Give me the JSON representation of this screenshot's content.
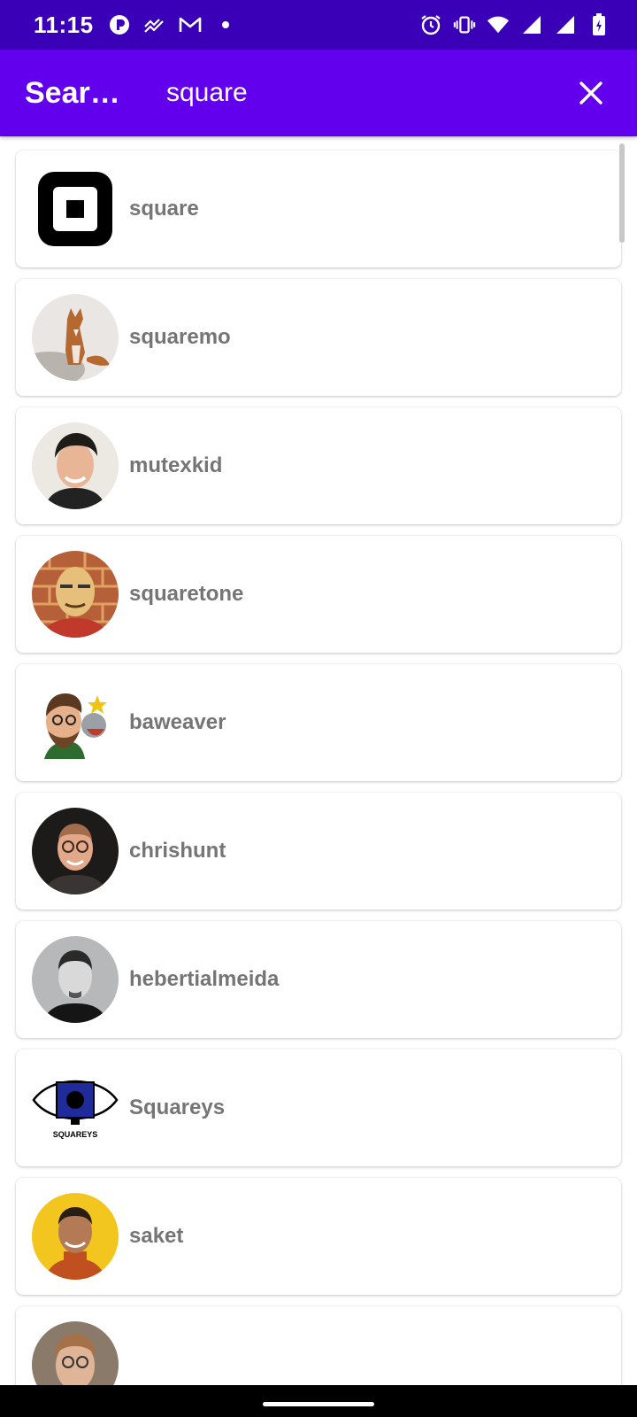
{
  "status_bar": {
    "time": "11:15",
    "left_icons": [
      "app-notification-icon",
      "analytics-icon",
      "gmail-icon",
      "dot-icon"
    ],
    "right_icons": [
      "alarm-icon",
      "vibrate-icon",
      "wifi-icon",
      "signal-icon",
      "signal-icon",
      "battery-charging-icon"
    ]
  },
  "app_bar": {
    "title": "Sear…",
    "search_value": "square",
    "background": "#6200ee",
    "close_icon": "close-icon"
  },
  "results": [
    {
      "name": "square",
      "avatar": "square-logo"
    },
    {
      "name": "squaremo",
      "avatar": "fox-photo"
    },
    {
      "name": "mutexkid",
      "avatar": "person-photo"
    },
    {
      "name": "squaretone",
      "avatar": "person-photo"
    },
    {
      "name": "baweaver",
      "avatar": "cartoon-avatar"
    },
    {
      "name": "chrishunt",
      "avatar": "person-photo"
    },
    {
      "name": "hebertialmeida",
      "avatar": "person-photo"
    },
    {
      "name": "Squareys",
      "avatar": "squareys-logo",
      "logo_text": "SQUAREYS"
    },
    {
      "name": "saket",
      "avatar": "person-photo"
    },
    {
      "name": "",
      "avatar": "person-photo"
    }
  ],
  "colors": {
    "status_bar": "#3a00b7",
    "app_bar": "#6200ee",
    "name_text": "#757575"
  }
}
